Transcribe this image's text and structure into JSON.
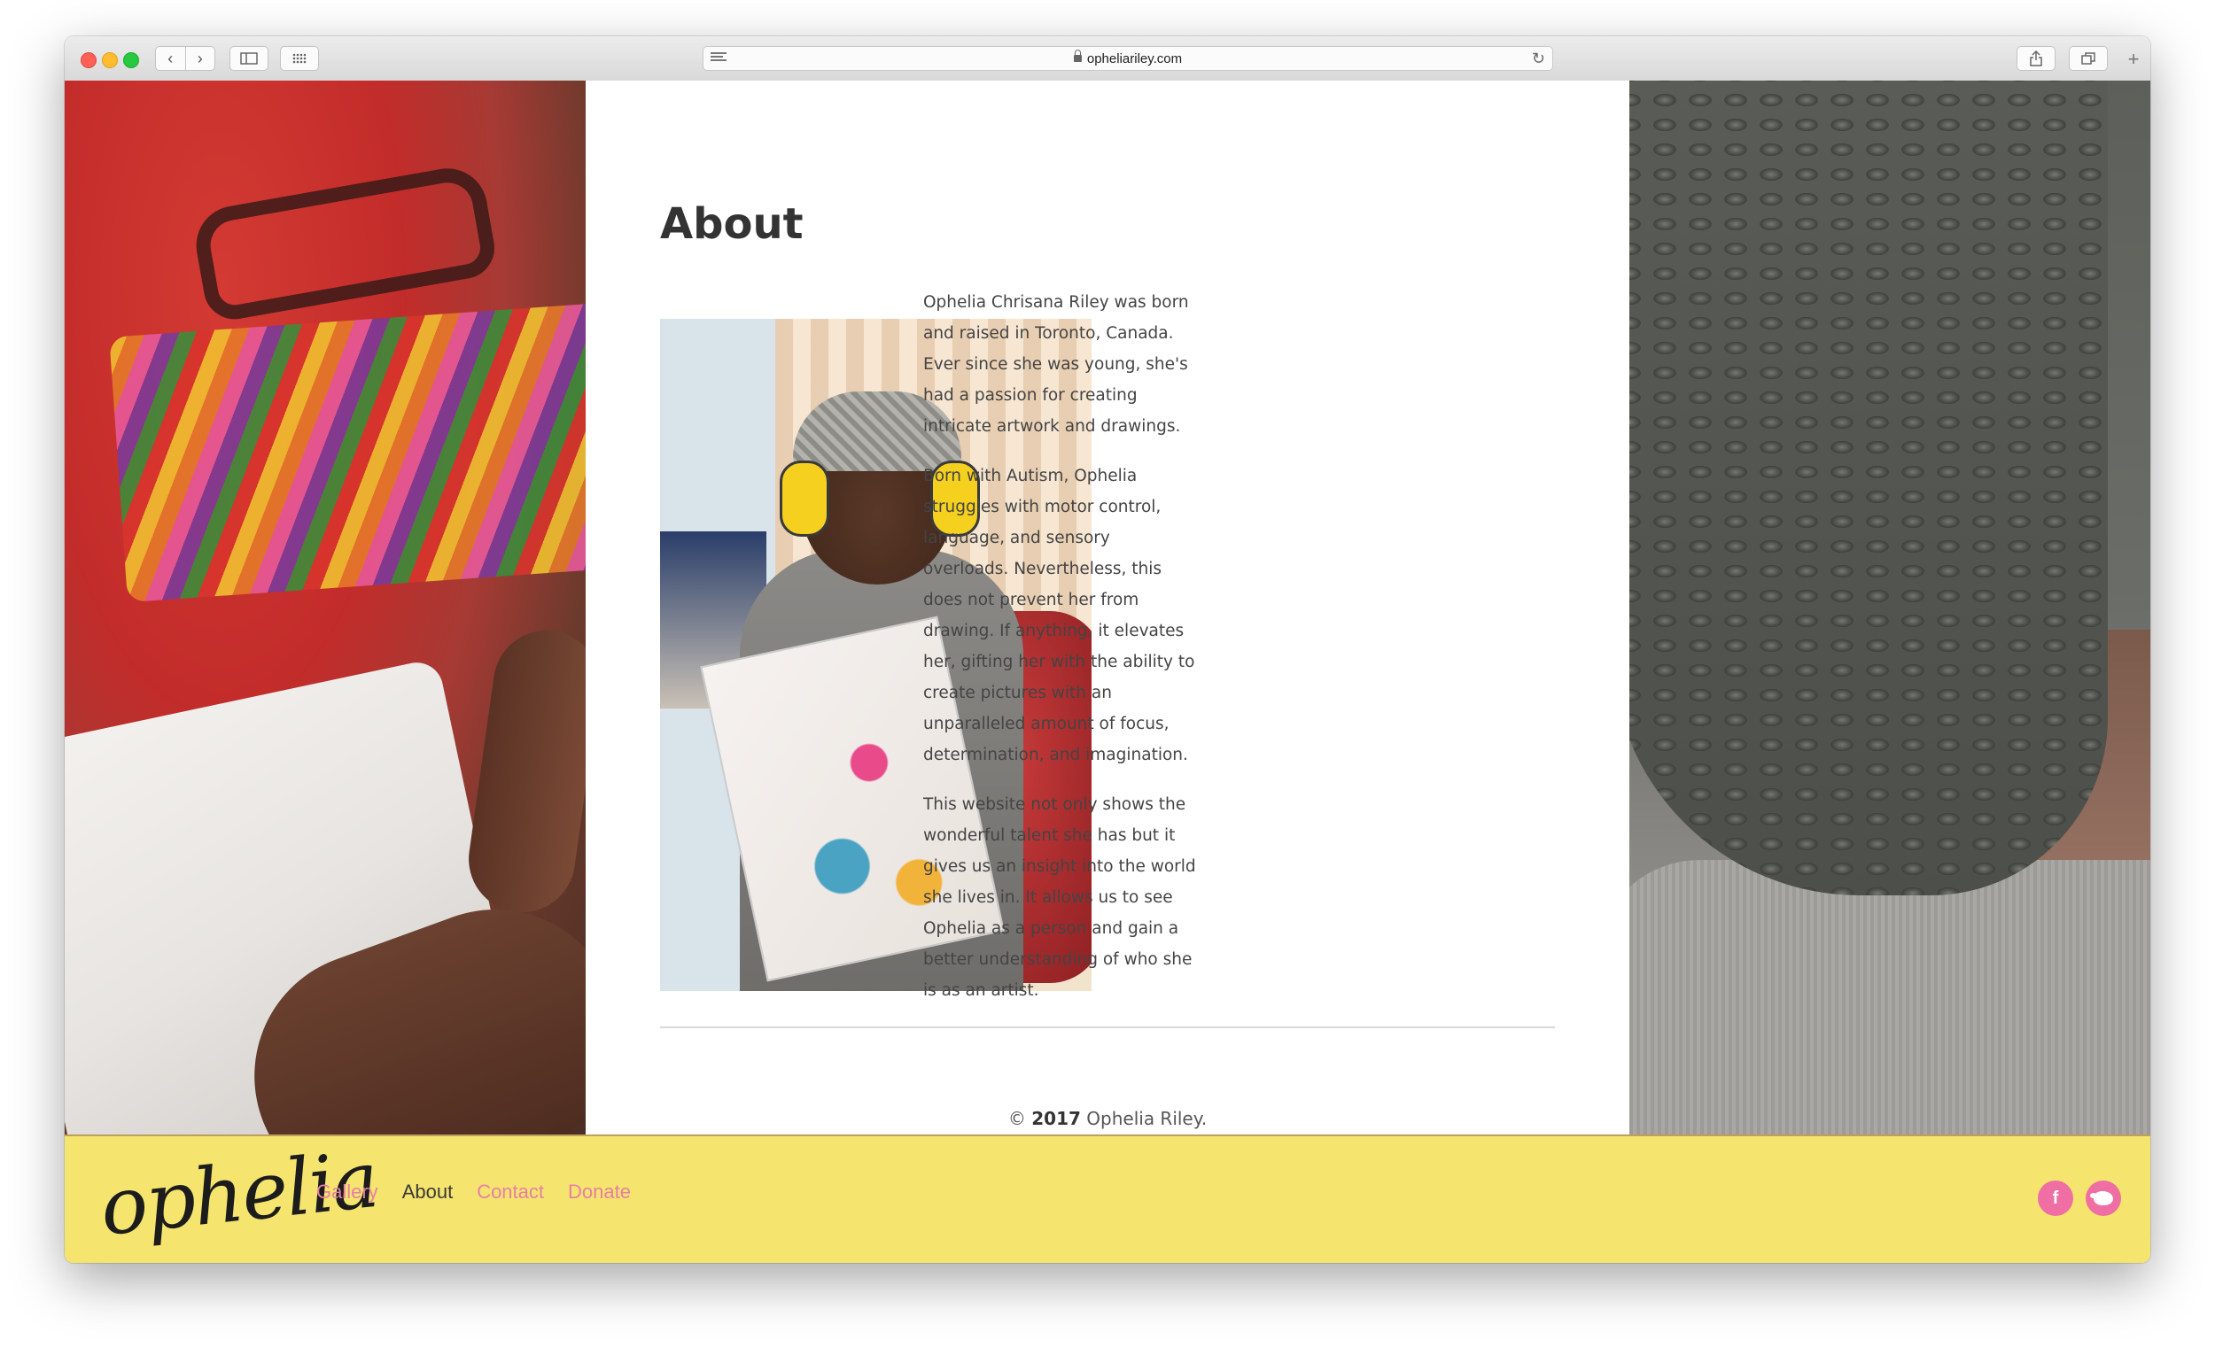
{
  "browser": {
    "url": "opheliariley.com",
    "nav_back": "‹",
    "nav_forward": "›",
    "reload": "↻"
  },
  "content": {
    "title": "About",
    "paragraphs": [
      "Ophelia Chrisana Riley was born and raised in Toronto, Canada. Ever since she was young, she's had a passion for creating intricate artwork and drawings.",
      "Born with Autism, Ophelia struggles with motor control, language, and sensory overloads. Nevertheless, this does not prevent her from drawing. If anything, it elevates her, gifting her with the ability to create pictures with an unparalleled amount of focus, determination, and imagination.",
      "This website not only shows the wonderful talent she has but it gives us an insight into the world she lives in. It allows us to see Ophelia as a person and gain a better understanding of who she is as an artist."
    ],
    "copyright_symbol": "©",
    "copyright_year": "2017",
    "copyright_name": "Ophelia Riley."
  },
  "footer": {
    "logo_text": "ophelia",
    "nav": [
      {
        "label": "Gallery",
        "active": false
      },
      {
        "label": "About",
        "active": true
      },
      {
        "label": "Contact",
        "active": false
      },
      {
        "label": "Donate",
        "active": false
      }
    ],
    "social": {
      "facebook": "f"
    }
  },
  "colors": {
    "footer_bg": "#f5e46e",
    "nav_link": "#e87fa7",
    "nav_active": "#3a3a3a",
    "social_bg": "#ef6fa4"
  },
  "icons": [
    "reader-icon",
    "lock-icon",
    "reload-icon",
    "sidebar-icon",
    "grid-icon",
    "share-icon",
    "tabs-icon",
    "new-tab-icon",
    "facebook-icon",
    "twitter-icon"
  ]
}
